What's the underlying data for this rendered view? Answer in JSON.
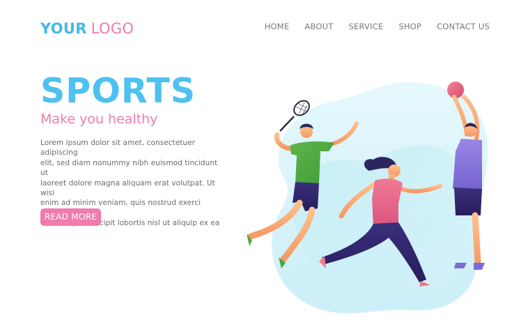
{
  "header": {
    "logo_your": "YOUR",
    "logo_word": "LOGO",
    "nav": [
      {
        "label": "HOME"
      },
      {
        "label": "ABOUT"
      },
      {
        "label": "SERVICE"
      },
      {
        "label": "SHOP"
      },
      {
        "label": "CONTACT US"
      }
    ]
  },
  "hero": {
    "title": "SPORTS",
    "subtitle": "Make you healthy",
    "body": "Lorem ipsum dolor sit amet, consectetuer adipiscing\nelit, sed diam nonummy nibh euismod tincidunt ut\nlaoreet dolore magna aliquam erat volutpat. Ut wisi\nenim ad minim veniam, quis nostrud exerci tation\nullamcorper suscipit lobortis nisl ut aliquip ex ea",
    "cta_label": "READ MORE"
  },
  "colors": {
    "brand_blue": "#43b8ea",
    "brand_pink": "#ef7cab",
    "text_gray": "#6f6f6f",
    "blob_light": "#dcf5fb",
    "blob_mid": "#bfe8f6"
  },
  "illustration": {
    "figures": [
      "badminton-player-icon",
      "running-woman-icon",
      "basketball-player-icon"
    ]
  }
}
